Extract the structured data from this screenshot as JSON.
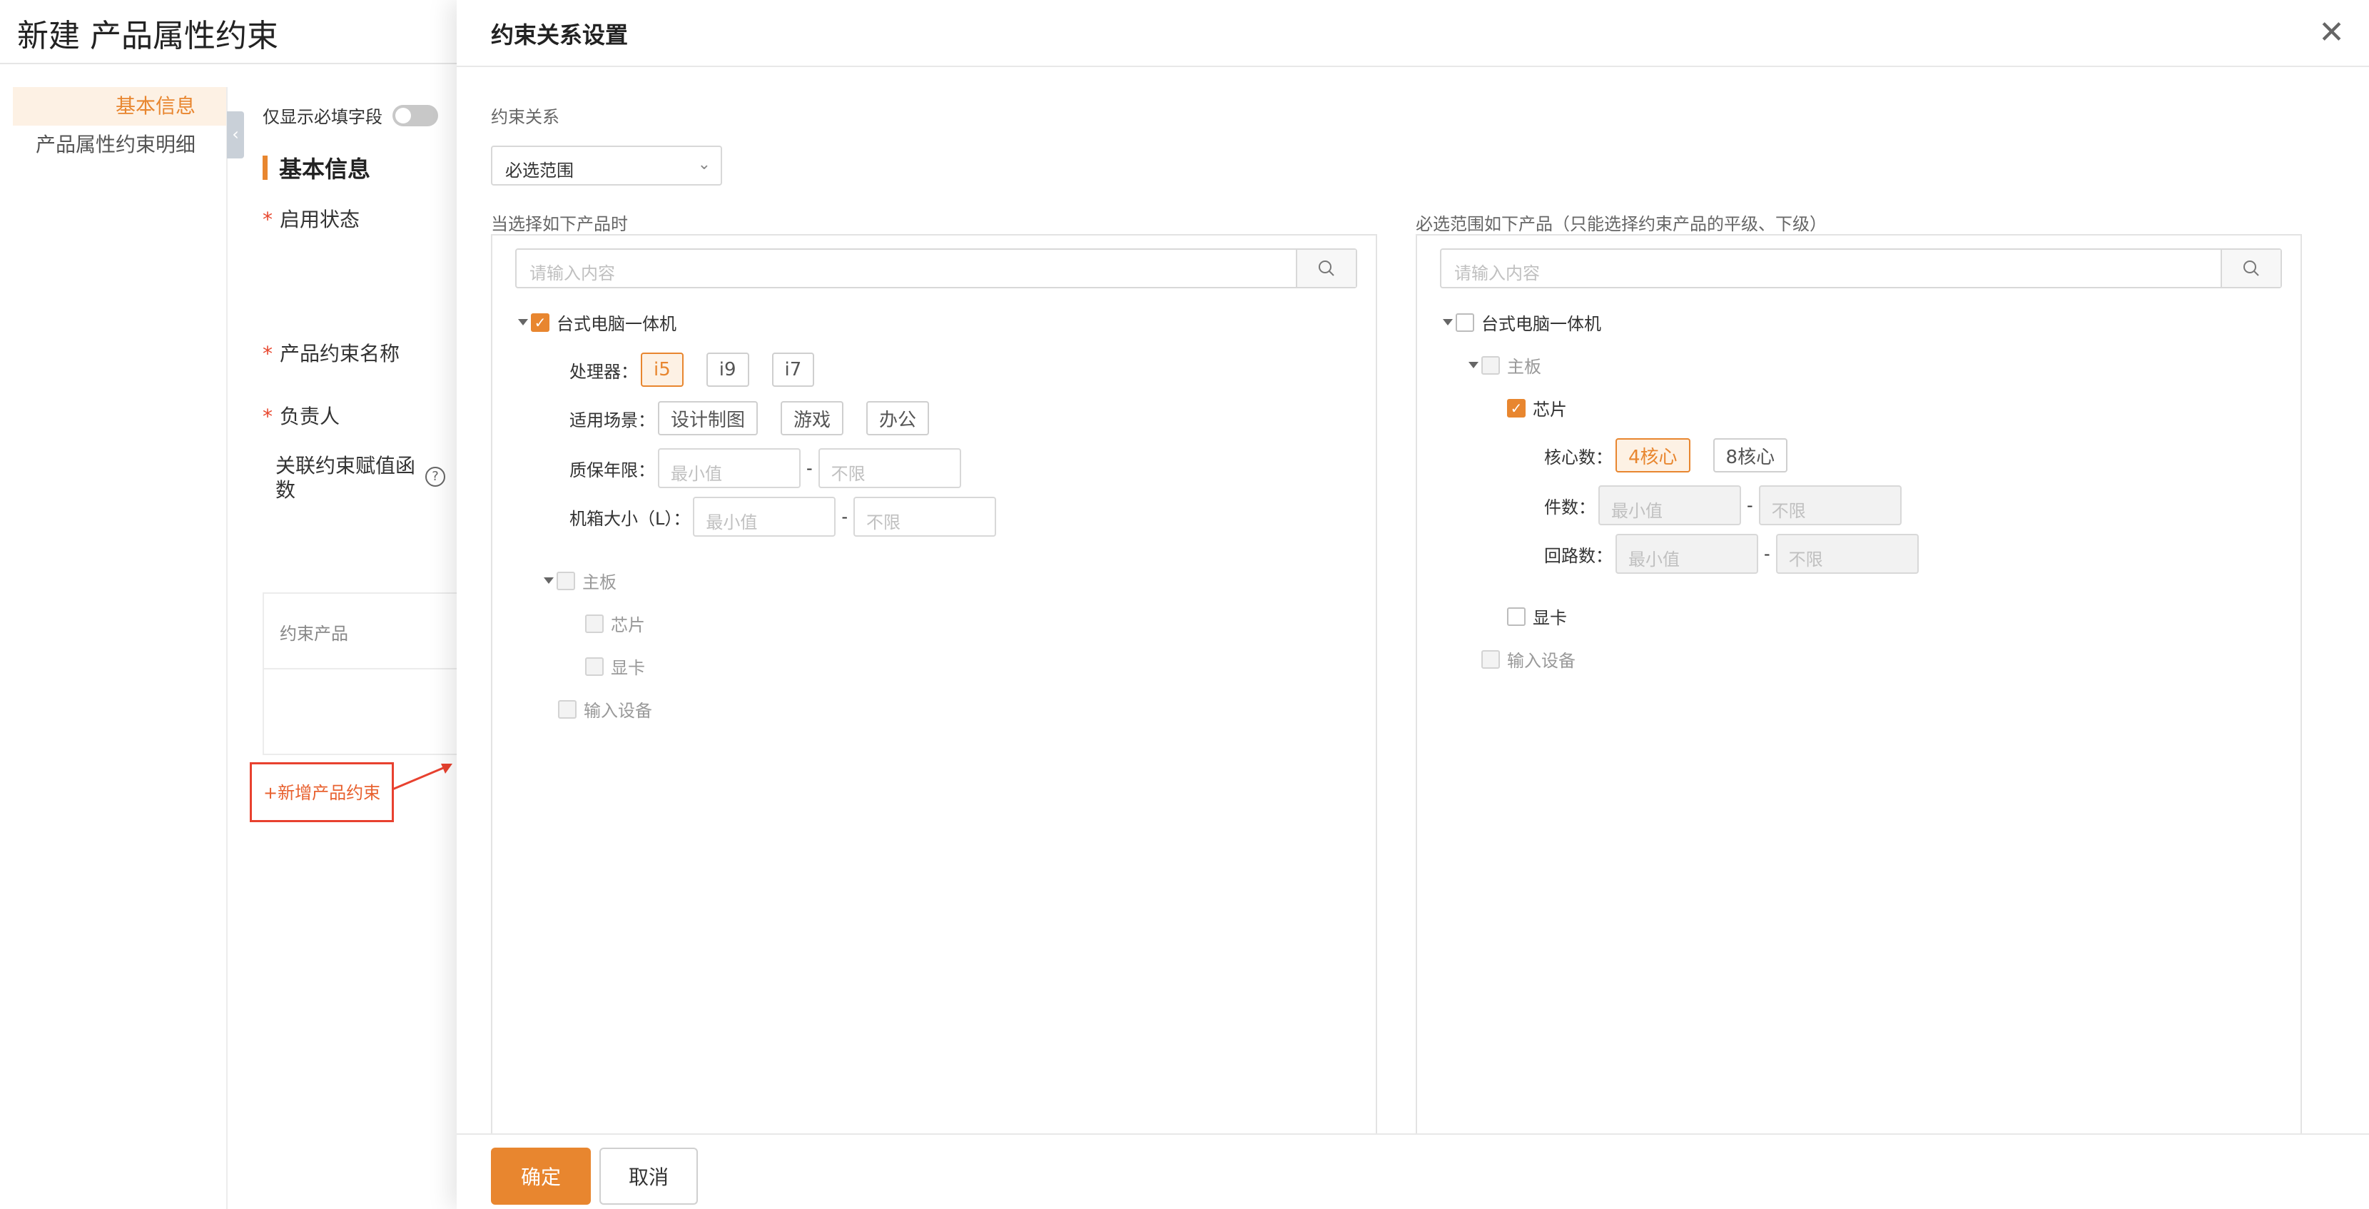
{
  "page": {
    "title": "新建 产品属性约束",
    "nav": [
      {
        "label": "基本信息"
      },
      {
        "label": "产品属性约束明细"
      }
    ],
    "required_toggle_label": "仅显示必填字段",
    "section_title": "基本信息",
    "fields": {
      "status": "启用状态",
      "constraint_name": "产品约束名称",
      "owner": "负责人",
      "assign_fn": "关联约束赋值函数"
    },
    "table_header": "约束产品",
    "add_button": "+新增产品约束"
  },
  "dialog": {
    "title": "约束关系设置",
    "relation_label": "约束关系",
    "relation_value": "必选范围",
    "left_title": "当选择如下产品时",
    "right_title": "必选范围如下产品（只能选择约束产品的平级、下级）",
    "search_placeholder": "请输入内容",
    "left": {
      "root": "台式电脑一体机",
      "cpu_label": "处理器：",
      "cpu_options": [
        "i5",
        "i9",
        "i7"
      ],
      "cpu_selected": "i5",
      "scene_label": "适用场景：",
      "scene_options": [
        "设计制图",
        "游戏",
        "办公"
      ],
      "warranty_label": "质保年限：",
      "case_label": "机箱大小（L）：",
      "min_placeholder": "最小值",
      "max_placeholder": "不限",
      "board": "主板",
      "chip": "芯片",
      "gpu": "显卡",
      "input": "输入设备"
    },
    "right": {
      "root": "台式电脑一体机",
      "board": "主板",
      "chip": "芯片",
      "core_label": "核心数：",
      "core_options": [
        "4核心",
        "8核心"
      ],
      "core_selected": "4核心",
      "count_label": "件数：",
      "loop_label": "回路数：",
      "min_placeholder": "最小值",
      "max_placeholder": "不限",
      "gpu": "显卡",
      "input": "输入设备"
    },
    "confirm": "确定",
    "cancel": "取消"
  },
  "colors": {
    "accent": "#e8862f",
    "annotation_red": "#e8412f"
  }
}
